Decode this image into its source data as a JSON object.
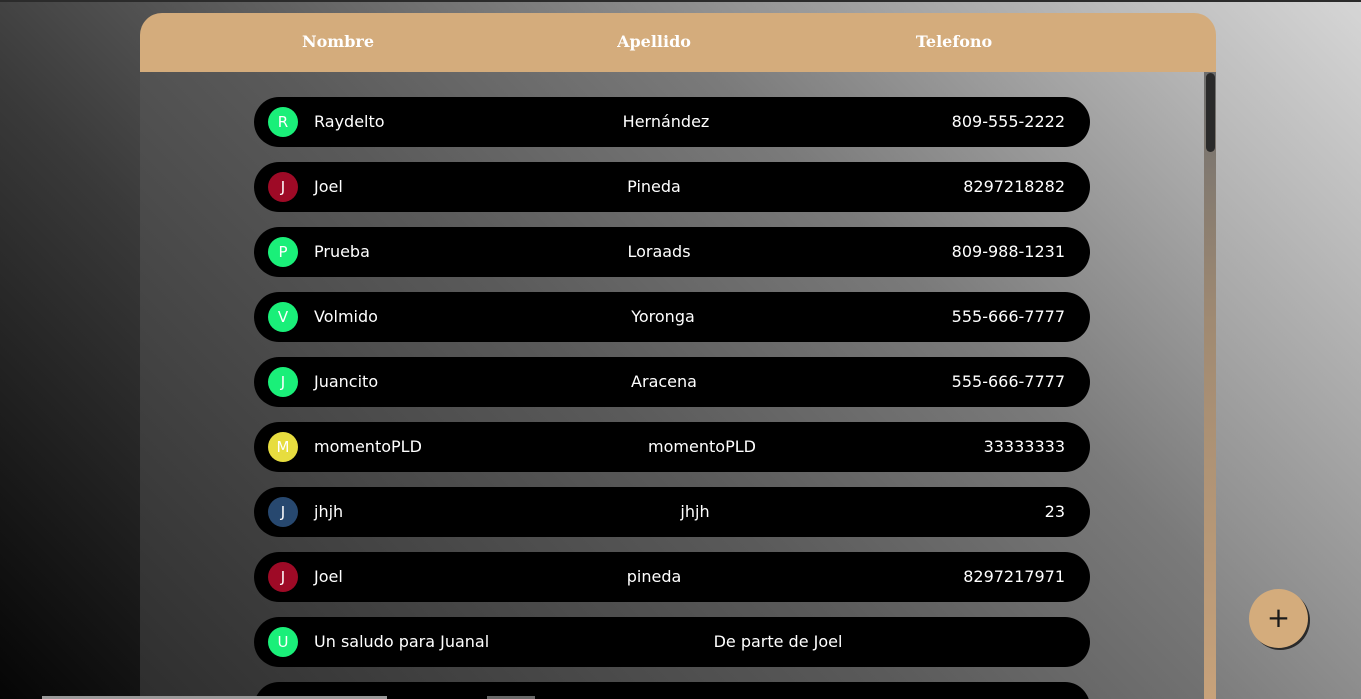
{
  "header": {
    "col_first_name": "Nombre",
    "col_last_name": "Apellido",
    "col_phone": "Telefono"
  },
  "contacts": [
    {
      "initial": "R",
      "first_name": "Raydelto",
      "last_name": "Hernández",
      "phone": "809-555-2222",
      "avatar_color": "#1aef79"
    },
    {
      "initial": "J",
      "first_name": "Joel",
      "last_name": "Pineda",
      "phone": "8297218282",
      "avatar_color": "#9e0a26"
    },
    {
      "initial": "P",
      "first_name": "Prueba",
      "last_name": "Loraads",
      "phone": "809-988-1231",
      "avatar_color": "#1aef79"
    },
    {
      "initial": "V",
      "first_name": "Volmido",
      "last_name": "Yoronga",
      "phone": "555-666-7777",
      "avatar_color": "#1aef79"
    },
    {
      "initial": "J",
      "first_name": "Juancito",
      "last_name": "Aracena",
      "phone": "555-666-7777",
      "avatar_color": "#1aef79"
    },
    {
      "initial": "M",
      "first_name": "momentoPLD",
      "last_name": "momentoPLD",
      "phone": "33333333",
      "avatar_color": "#e7dd3f"
    },
    {
      "initial": "J",
      "first_name": "jhjh",
      "last_name": "jhjh",
      "phone": "23",
      "avatar_color": "#27486f"
    },
    {
      "initial": "J",
      "first_name": "Joel",
      "last_name": "pineda",
      "phone": "8297217971",
      "avatar_color": "#9e0a26"
    },
    {
      "initial": "U",
      "first_name": "Un saludo para Juanal",
      "last_name": "De parte de Joel",
      "phone": "",
      "avatar_color": "#1aef79"
    }
  ],
  "fab": {
    "label": "+",
    "icon": "plus-icon"
  },
  "colors": {
    "accent": "#d4ac7c",
    "row_bg": "#000000"
  }
}
